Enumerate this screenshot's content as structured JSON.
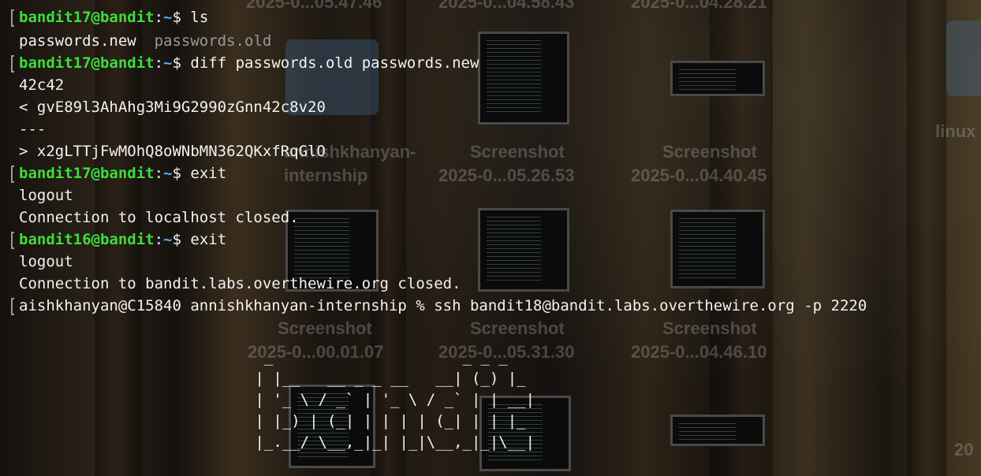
{
  "desktop": {
    "labels": [
      {
        "text": "2025-0...05.47.46"
      },
      {
        "text": "2025-0...04.58.43"
      },
      {
        "text": "2025-0...04.28.21"
      },
      {
        "text": "linux"
      },
      {
        "text": "annishkhanyan-"
      },
      {
        "text": "internship"
      },
      {
        "text": "Screenshot"
      },
      {
        "text": "2025-0...05.26.53"
      },
      {
        "text": "Screenshot"
      },
      {
        "text": "2025-0...04.40.45"
      },
      {
        "text": "Screenshot"
      },
      {
        "text": "2025-0...00.01.07"
      },
      {
        "text": "Screenshot"
      },
      {
        "text": "2025-0...05.31.30"
      },
      {
        "text": "Screenshot"
      },
      {
        "text": "2025-0...04.46.10"
      },
      {
        "text": "20"
      }
    ]
  },
  "terminal": {
    "l1": {
      "user": "bandit17@bandit",
      "sep": ":",
      "path": "~",
      "cmd": "$ ls"
    },
    "l2": {
      "a": "passwords.new",
      "b": "passwords.old"
    },
    "l3": {
      "user": "bandit17@bandit",
      "sep": ":",
      "path": "~",
      "cmd": "$ diff passwords.old passwords.new"
    },
    "l4": "42c42",
    "l5": "< gvE89l3AhAhg3Mi9G2990zGnn42c8v20",
    "l6": "---",
    "l7": "> x2gLTTjFwMOhQ8oWNbMN362QKxfRqGlO",
    "l8": {
      "user": "bandit17@bandit",
      "sep": ":",
      "path": "~",
      "cmd": "$ exit"
    },
    "l9": "logout",
    "l10": "Connection to localhost closed.",
    "l11": {
      "user": "bandit16@bandit",
      "sep": ":",
      "path": "~",
      "cmd": "$ exit"
    },
    "l12": "logout",
    "l13": "Connection to bandit.labs.overthewire.org closed.",
    "l14": "aishkhanyan@C15840 annishkhanyan-internship % ssh bandit18@bandit.labs.overthewire.org -p 2220",
    "ascii_banner": "  _                     _ _ _   \n | |__   __ _ _ __   __| (_) |_ \n | '_ \\ / _` | '_ \\ / _` | | __|\n | |_) | (_| | | | | (_| | | |_ \n |_.__/ \\__,_|_| |_|\\__,_|_|\\__|"
  }
}
